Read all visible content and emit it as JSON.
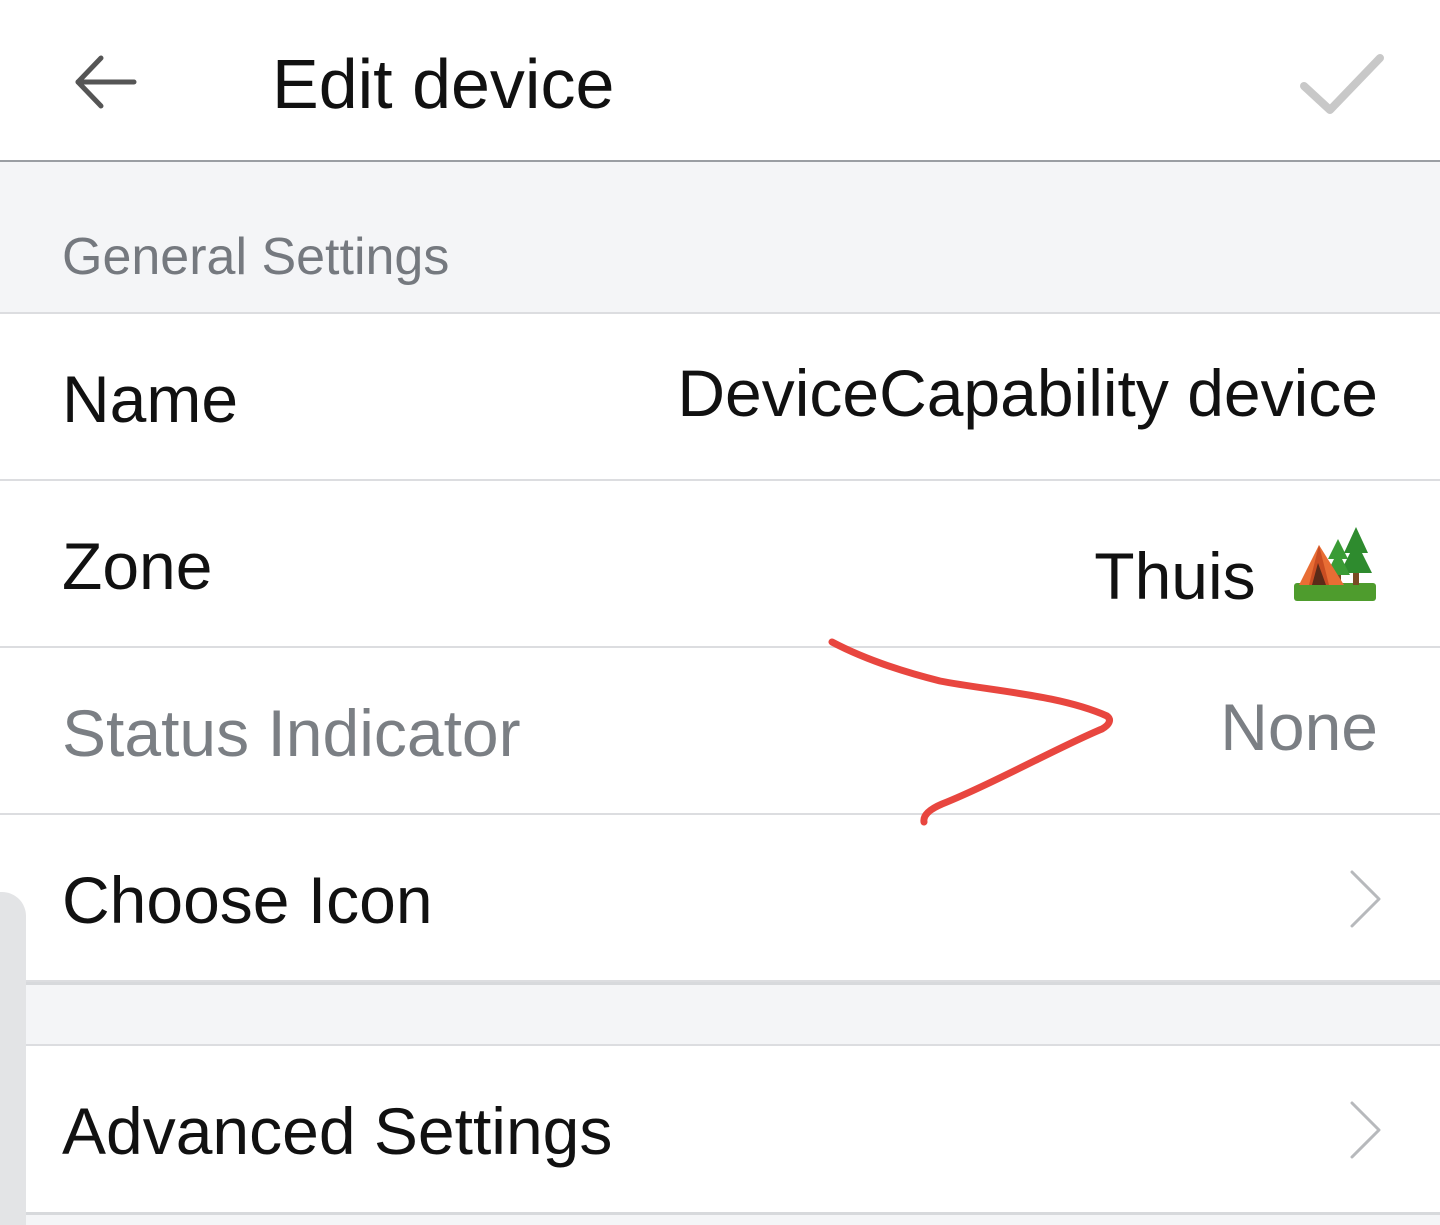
{
  "header": {
    "title": "Edit device",
    "back_icon": "back-arrow-icon",
    "confirm_icon": "checkmark-icon"
  },
  "general_settings": {
    "title": "General Settings",
    "rows": [
      {
        "label": "Name",
        "value": "DeviceCapability device"
      },
      {
        "label": "Zone",
        "value": "Thuis",
        "value_icon": "camping-tent-icon"
      },
      {
        "label": "Status Indicator",
        "value": "None",
        "disabled": true
      },
      {
        "label": "Choose Icon",
        "trailing_icon": "chevron-right-icon"
      }
    ]
  },
  "advanced": {
    "label": "Advanced Settings",
    "trailing_icon": "chevron-right-icon"
  },
  "colors": {
    "text_primary": "#111111",
    "text_secondary": "#7b7f84",
    "section_background": "#f4f5f7",
    "divider": "#dcdde0",
    "annotation_red": "#e8463f"
  }
}
